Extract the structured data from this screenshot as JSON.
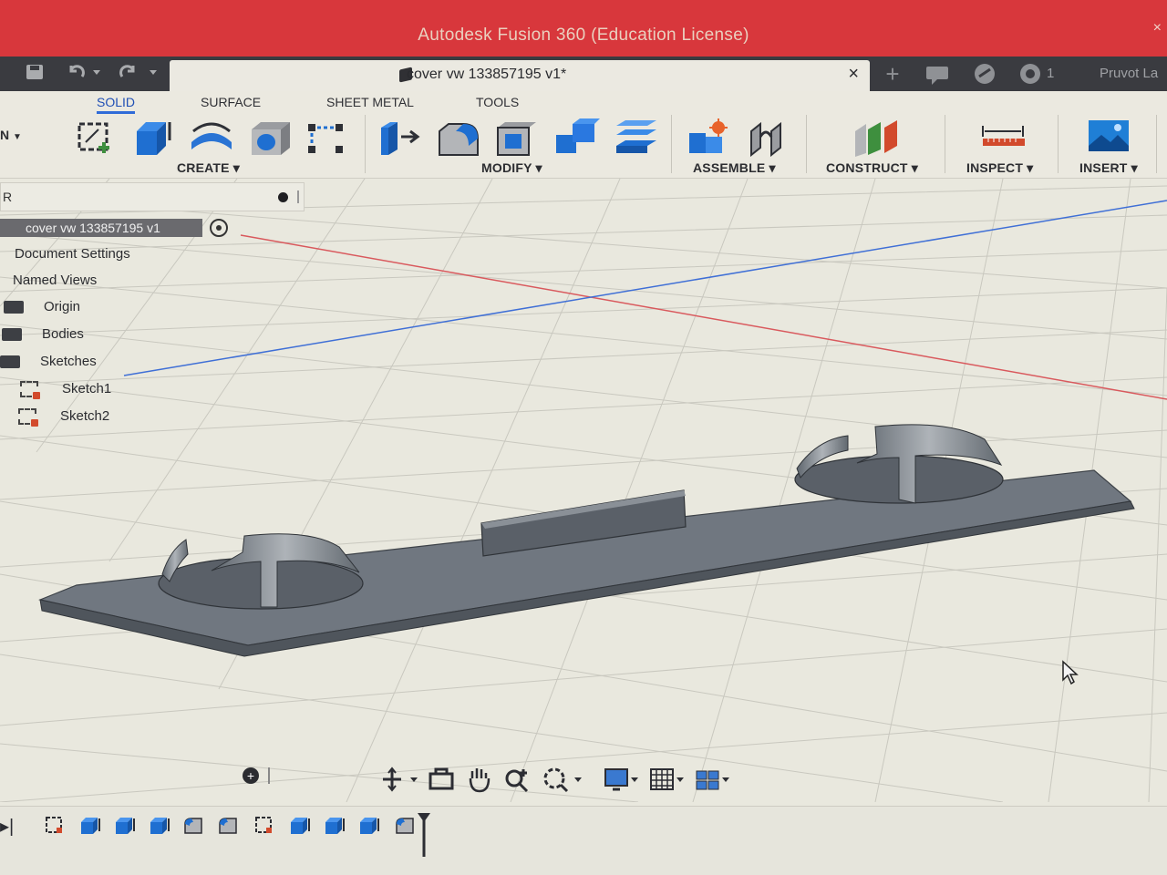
{
  "window": {
    "title": "Autodesk Fusion 360 (Education License)",
    "close_glyph": "×"
  },
  "quick_access": {
    "doc_tab_label": "cover vw 133857195 v1*",
    "close_tab": "×",
    "new_tab": "+",
    "notifications_count": "1",
    "user_label": "Pruvot La"
  },
  "workspace": {
    "left_label": "N"
  },
  "tabs": [
    "SOLID",
    "SURFACE",
    "SHEET METAL",
    "TOOLS"
  ],
  "groups": {
    "create": "CREATE ▾",
    "modify": "MODIFY ▾",
    "assemble": "ASSEMBLE ▾",
    "construct": "CONSTRUCT ▾",
    "inspect": "INSPECT ▾",
    "insert": "INSERT ▾"
  },
  "browser": {
    "header_label": "R",
    "root": "cover vw 133857195 v1",
    "items": {
      "document_settings": "Document Settings",
      "named_views": "Named Views",
      "origin": "Origin",
      "bodies": "Bodies",
      "sketches": "Sketches",
      "sketch1": "Sketch1",
      "sketch2": "Sketch2"
    }
  },
  "colors": {
    "title_bar": "#d8373c",
    "quick_access_bar": "#3a3b40",
    "toolbar_bg": "#ebe9e0",
    "viewport_bg": "#e9e8de",
    "grid_line": "#c9c8bf",
    "axis_red": "#d9595d",
    "axis_blue": "#3f6fd6",
    "model_gray": "#6e757d",
    "accent_blue": "#2f6bd8"
  },
  "icons": {
    "nav": [
      "orbit-icon",
      "look-at-icon",
      "pan-icon",
      "zoom-icon",
      "fit-icon",
      "display-settings-icon",
      "grid-icon",
      "viewports-icon"
    ],
    "timeline": [
      "sketch-icon",
      "extrude-icon",
      "extrude-icon",
      "extrude-icon",
      "fillet-icon",
      "fillet-icon",
      "sketch-icon",
      "extrude-icon",
      "extrude-icon",
      "extrude-icon",
      "fillet-icon"
    ]
  }
}
